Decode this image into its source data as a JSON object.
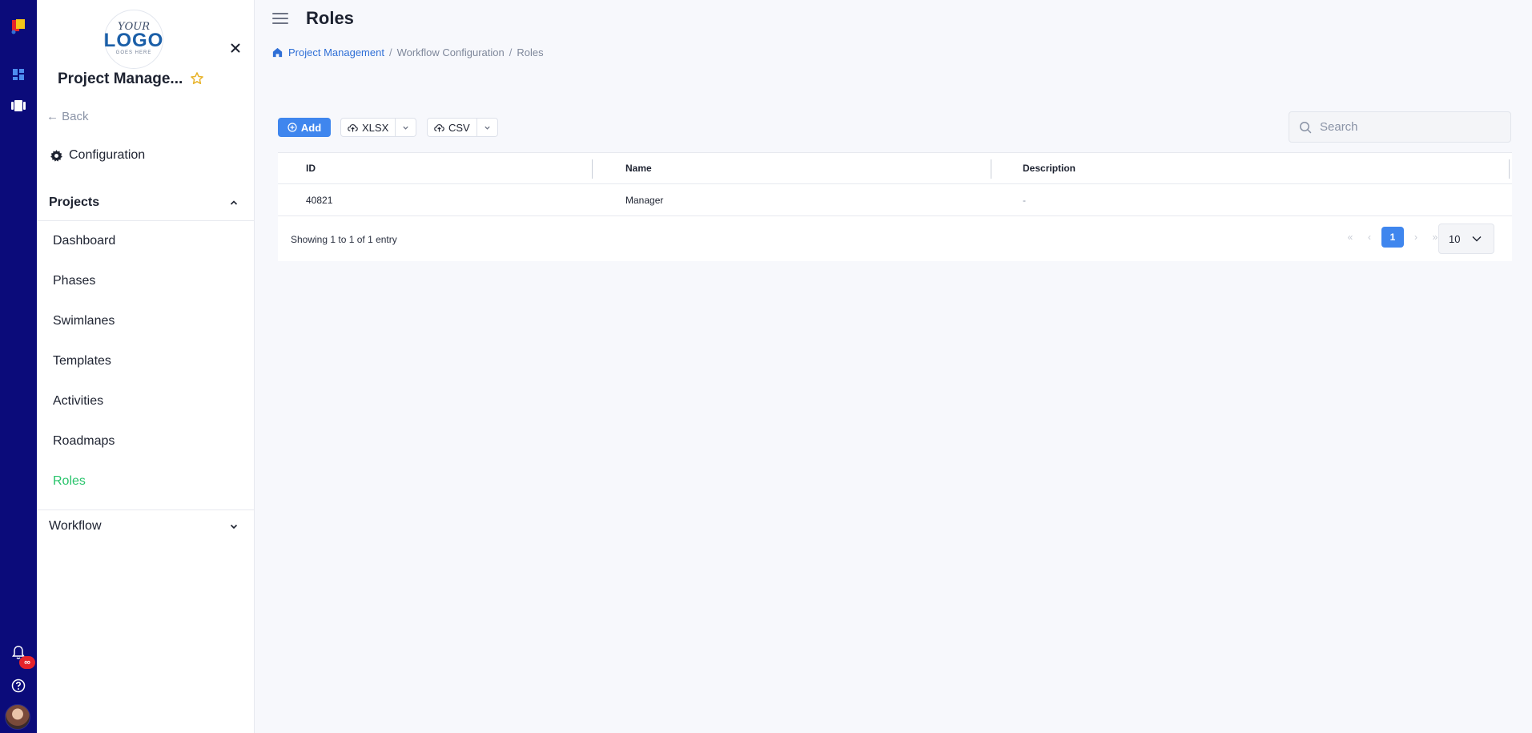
{
  "app": {
    "notification_badge": "∞",
    "colors": {
      "rail": "#0b0b7a",
      "primary": "#3f86ee",
      "active_menu": "#28c46b",
      "link": "#2f6fd6"
    }
  },
  "sidebar": {
    "logo": {
      "line1": "YOUR",
      "line2": "LOGO",
      "line3": "GOES HERE"
    },
    "project_title": "Project Manage...",
    "back_label": "← Back",
    "configuration_label": "Configuration",
    "projects_section": "Projects",
    "items": [
      {
        "label": "Dashboard"
      },
      {
        "label": "Phases"
      },
      {
        "label": "Swimlanes"
      },
      {
        "label": "Templates"
      },
      {
        "label": "Activities"
      },
      {
        "label": "Roadmaps"
      },
      {
        "label": "Roles"
      }
    ],
    "active_item": "Roles",
    "workflow_section": "Workflow"
  },
  "header": {
    "title": "Roles",
    "breadcrumb": {
      "root": "Project Management",
      "separator": "/",
      "middle": "Workflow Configuration",
      "current": "Roles"
    }
  },
  "toolbar": {
    "add_label": "Add",
    "xlsx_label": "XLSX",
    "csv_label": "CSV",
    "search_placeholder": "Search"
  },
  "table": {
    "columns": [
      "ID",
      "Name",
      "Description"
    ],
    "rows": [
      {
        "id": "40821",
        "name": "Manager",
        "description": "-"
      }
    ],
    "footer_info": "Showing 1 to 1 of 1 entry",
    "current_page": "1",
    "per_page": "10"
  }
}
